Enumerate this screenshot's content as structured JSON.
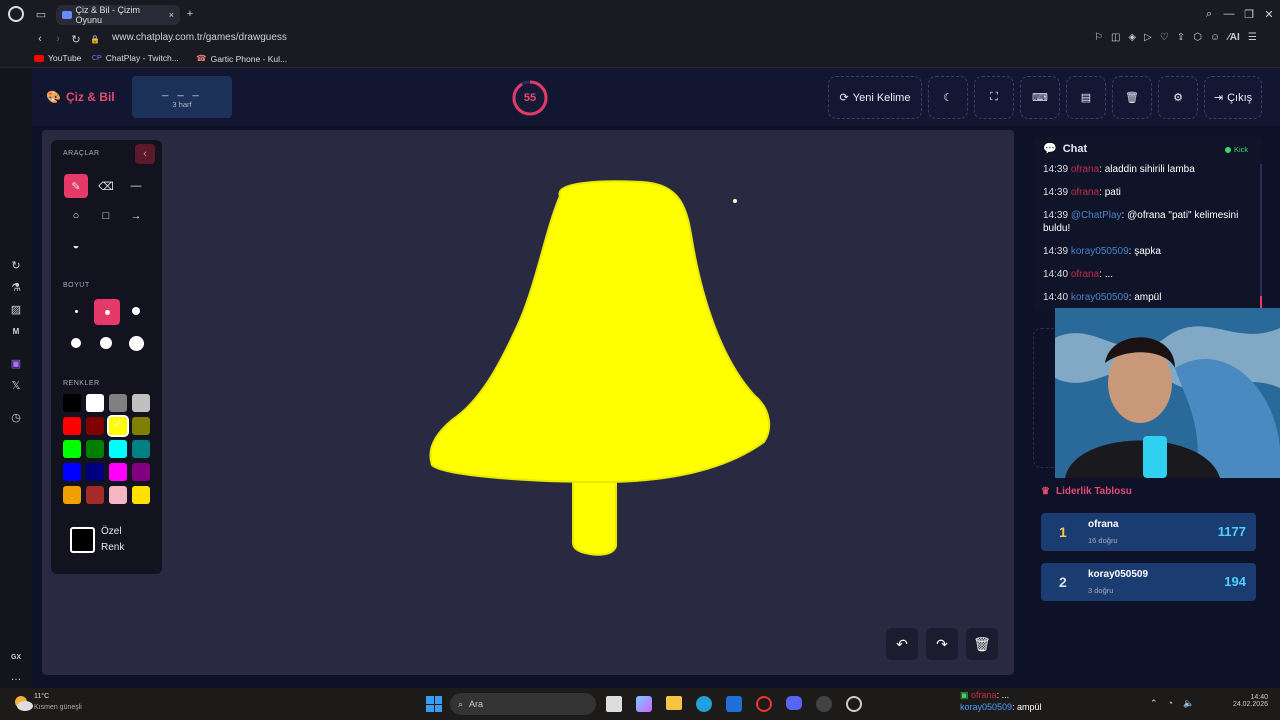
{
  "browser": {
    "tab_title": "Çiz & Bil - Çizim Oyunu",
    "url": "www.chatplay.com.tr/games/drawguess",
    "bookmarks": [
      "YouTube",
      "ChatPlay - Twitch...",
      "Gartic Phone - Kul..."
    ]
  },
  "header": {
    "logo": "Çiz & Bil",
    "word": "_ _ _",
    "word_hint": "3 harf",
    "timer": "55",
    "new_word": "Yeni Kelime",
    "exit": "Çıkış"
  },
  "tools": {
    "section_tools": "ARAÇLAR",
    "section_size": "BOYUT",
    "section_colors": "RENKLER",
    "custom_color_line1": "Özel",
    "custom_color_line2": "Renk",
    "colors": [
      "#000000",
      "#ffffff",
      "#808080",
      "#c0c0c0",
      "#ff0000",
      "#800000",
      "#ffff00",
      "#808000",
      "#00ff00",
      "#008000",
      "#00ffff",
      "#008080",
      "#0000ff",
      "#000080",
      "#ff00ff",
      "#800080",
      "#f0a000",
      "#a52a2a",
      "#f4b6c2",
      "#ffe000"
    ]
  },
  "chat": {
    "title": "Chat",
    "platform": "Kick",
    "messages": [
      {
        "time": "14:39",
        "user": "ofrana",
        "text": ": aladdin sihirili lamba",
        "color": "u1"
      },
      {
        "time": "14:39",
        "user": "ofrana",
        "text": ": pati",
        "color": "u1"
      },
      {
        "time": "14:39",
        "user": "@ChatPlay",
        "text": ": @ofrana \"pati\" kelimesini buldu!",
        "color": "u2"
      },
      {
        "time": "14:39",
        "user": "koray050509",
        "text": ": şapka",
        "color": "u2"
      },
      {
        "time": "14:40",
        "user": "ofrana",
        "text": ": ...",
        "color": "u1"
      },
      {
        "time": "14:40",
        "user": "koray050509",
        "text": ": ampül",
        "color": "u2"
      }
    ]
  },
  "leaderboard": {
    "title": "Liderlik Tablosu",
    "rows": [
      {
        "rank": "1",
        "name": "ofrana",
        "sub": "16 doğru",
        "score": "1177"
      },
      {
        "rank": "2",
        "name": "koray050509",
        "sub": "3 doğru",
        "score": "194"
      }
    ]
  },
  "taskbar": {
    "search": "Ara",
    "weather_temp": "11°C",
    "weather_text": "Kısmen güneşli",
    "notif_user1": "ofrana",
    "notif_text1": ": ...",
    "notif_user2": "koray050509",
    "notif_text2": ": ampül",
    "clock_time": "14:40",
    "clock_date": "24.02.2026"
  },
  "colors": {
    "accent": "#e5396a",
    "bell": "#ffff00"
  }
}
